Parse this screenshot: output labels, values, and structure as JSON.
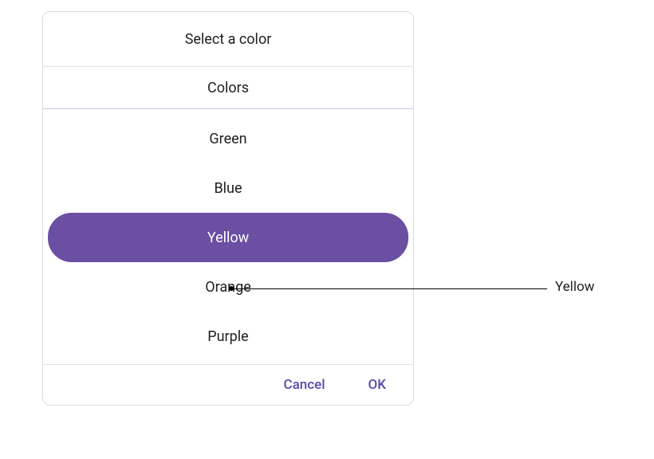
{
  "dialog": {
    "title": "Select a color",
    "section_label": "Colors",
    "items": [
      {
        "label": "Green",
        "selected": false
      },
      {
        "label": "Blue",
        "selected": false
      },
      {
        "label": "Yellow",
        "selected": true
      },
      {
        "label": "Orange",
        "selected": false
      },
      {
        "label": "Purple",
        "selected": false
      }
    ],
    "cancel_label": "Cancel",
    "ok_label": "OK",
    "accent_color": "#6a4fa3"
  },
  "annotation": {
    "label": "Yellow"
  }
}
